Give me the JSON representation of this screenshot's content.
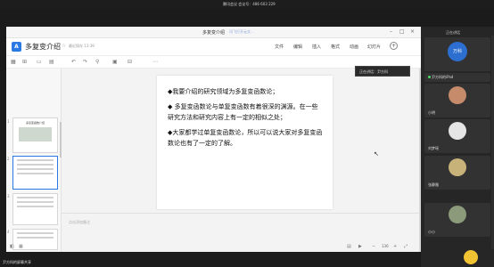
{
  "meeting_bar": {
    "text": "腾讯会议 会议号：486 603 229"
  },
  "window": {
    "document_name": "多复变介绍",
    "status": "讯飞打开云文..."
  },
  "header": {
    "logo_letter": "A",
    "title": "多复变介绍",
    "save_status": "最近保存 13:39",
    "menu": [
      "文件",
      "编辑",
      "插入",
      "格式",
      "动画",
      "幻灯片"
    ]
  },
  "slide": {
    "paragraphs": [
      "◆我要介绍的研究领域为多复变函数论；",
      "◆ 多复变函数论与单复变函数有着很深的渊源。在一些研究方法和研究内容上有一定的相似之处；",
      "◆大家都学过单复变函数论，所以可以说大家对多复变函数论也有了一定的了解。"
    ]
  },
  "thumbnails": {
    "first_title": "多复变函数介绍",
    "numbers": [
      "1",
      "2",
      "3",
      "4"
    ]
  },
  "notes": {
    "placeholder": "点击添加备注"
  },
  "status_bar": {
    "zoom": "136"
  },
  "tooltip": {
    "text": "正在讲话：尹方科"
  },
  "participants": {
    "header": "正在讲话",
    "list": [
      {
        "name": "万科",
        "color": "#2c6fd1"
      },
      {
        "name": "尹方科的iPad",
        "color": "#555555"
      },
      {
        "name": "小明",
        "color": "#c58b6a"
      },
      {
        "name": "刘梦瑶",
        "color": "#e5e5e5"
      },
      {
        "name": "张静雅",
        "color": "#c7b27a"
      },
      {
        "name": "小小",
        "color": "#8a9a7a"
      }
    ]
  },
  "bottom": {
    "status": "尹方科的屏幕共享"
  }
}
